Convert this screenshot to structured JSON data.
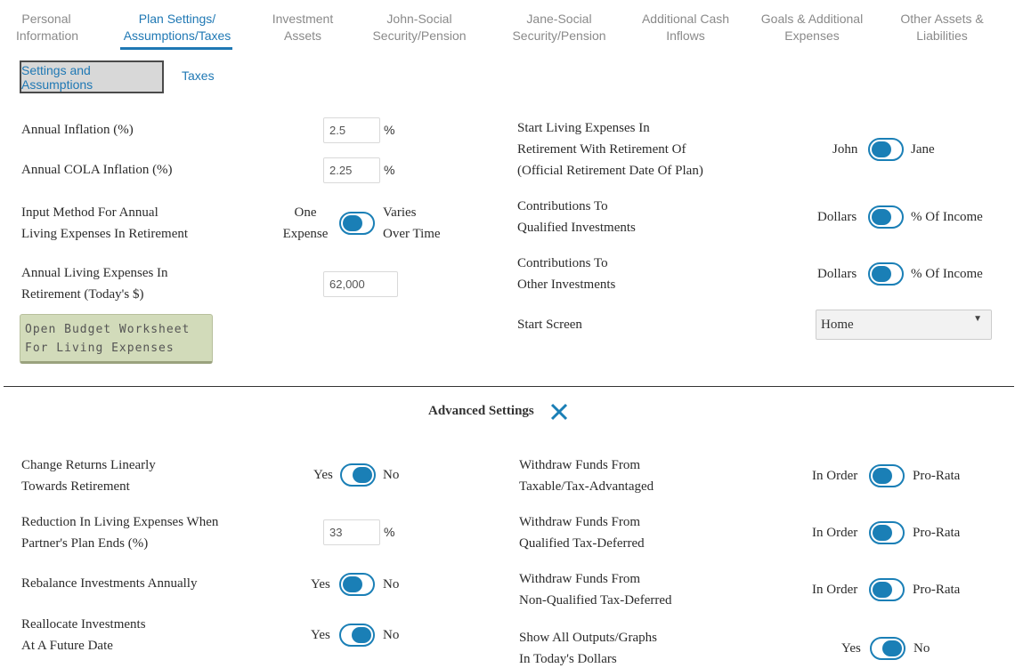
{
  "tabs": [
    {
      "label": "Personal\nInformation",
      "active": false
    },
    {
      "label": "Plan Settings/\nAssumptions/Taxes",
      "active": true
    },
    {
      "label": "Investment\nAssets",
      "active": false
    },
    {
      "label": "John-Social\nSecurity/Pension",
      "active": false
    },
    {
      "label": "Jane-Social\nSecurity/Pension",
      "active": false
    },
    {
      "label": "Additional Cash\nInflows",
      "active": false
    },
    {
      "label": "Goals & Additional\nExpenses",
      "active": false
    },
    {
      "label": "Other Assets &\nLiabilities",
      "active": false
    }
  ],
  "subtabs": {
    "settings": "Settings and Assumptions",
    "taxes": "Taxes"
  },
  "left": {
    "inflation": {
      "label": "Annual Inflation (%)",
      "value": "2.5",
      "unit": "%"
    },
    "cola": {
      "label": "Annual COLA Inflation (%)",
      "value": "2.25",
      "unit": "%"
    },
    "input_method": {
      "label": "Input Method For Annual\nLiving Expenses In Retirement",
      "left": "One\nExpense",
      "right": "Varies\nOver Time",
      "state": "left"
    },
    "living_expenses": {
      "label": "Annual Living Expenses In\nRetirement (Today's $)",
      "value": "62,000"
    },
    "budget_button": "Open Budget Worksheet\nFor Living Expenses"
  },
  "right": {
    "start_living": {
      "label": "Start Living Expenses In\nRetirement With Retirement Of\n(Official Retirement Date Of Plan)",
      "left": "John",
      "right": "Jane",
      "state": "left"
    },
    "contrib_qualified": {
      "label": "Contributions To\nQualified Investments",
      "left": "Dollars",
      "right": "% Of Income",
      "state": "left"
    },
    "contrib_other": {
      "label": "Contributions To\nOther Investments",
      "left": "Dollars",
      "right": "% Of Income",
      "state": "left"
    },
    "start_screen": {
      "label": "Start Screen",
      "value": "Home"
    }
  },
  "advanced": {
    "title": "Advanced Settings",
    "change_returns": {
      "label": "Change Returns Linearly\nTowards Retirement",
      "left": "Yes",
      "right": "No",
      "state": "right"
    },
    "reduction": {
      "label": "Reduction In Living Expenses When\nPartner's Plan Ends (%)",
      "value": "33",
      "unit": "%"
    },
    "rebalance": {
      "label": "Rebalance Investments Annually",
      "left": "Yes",
      "right": "No",
      "state": "left"
    },
    "reallocate": {
      "label": "Reallocate Investments\nAt A Future Date",
      "left": "Yes",
      "right": "No",
      "state": "right"
    },
    "withdraw_taxable": {
      "label": "Withdraw Funds From\nTaxable/Tax-Advantaged",
      "left": "In Order",
      "right": "Pro-Rata",
      "state": "left"
    },
    "withdraw_qualified": {
      "label": "Withdraw Funds From\nQualified Tax-Deferred",
      "left": "In Order",
      "right": "Pro-Rata",
      "state": "left"
    },
    "withdraw_nonqualified": {
      "label": "Withdraw Funds From\nNon-Qualified Tax-Deferred",
      "left": "In Order",
      "right": "Pro-Rata",
      "state": "left"
    },
    "show_outputs": {
      "label": "Show All Outputs/Graphs\nIn Today's Dollars",
      "left": "Yes",
      "right": "No",
      "state": "right"
    }
  },
  "colors": {
    "accent": "#1f78b4",
    "toggle": "#1a7fb6",
    "budget_button": "#d2dbba"
  }
}
